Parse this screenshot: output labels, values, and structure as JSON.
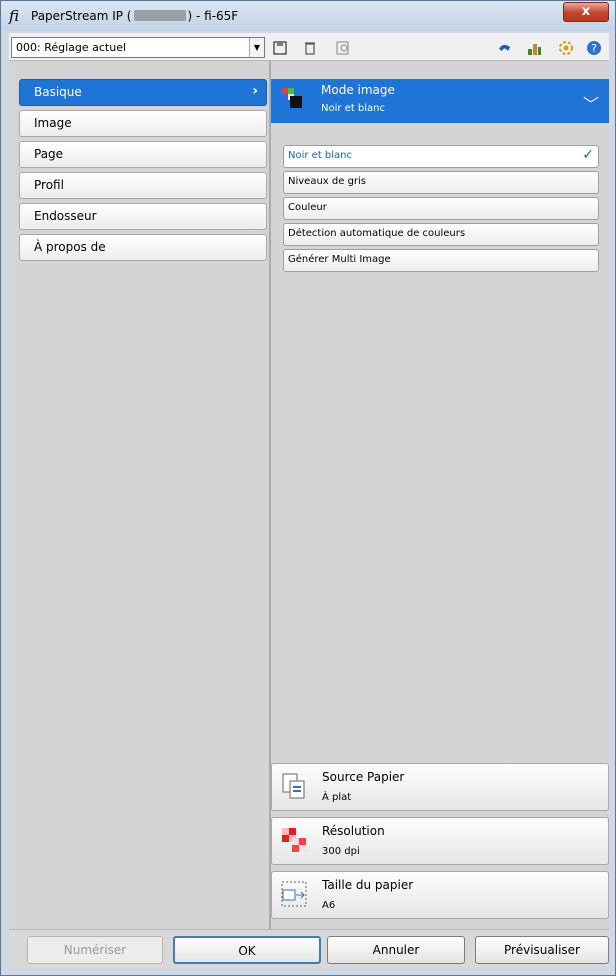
{
  "window": {
    "title_prefix": "PaperStream IP (",
    "title_suffix": ") - fi-65F",
    "close_label": "x"
  },
  "toolbar": {
    "preset_value": "000: Réglage actuel",
    "icons": [
      "save-icon",
      "delete-icon",
      "preview-scan-icon",
      "undo-icon",
      "profile-tree-icon",
      "settings-icon",
      "help-icon"
    ]
  },
  "nav": {
    "items": [
      {
        "label": "Basique",
        "active": true
      },
      {
        "label": "Image"
      },
      {
        "label": "Page"
      },
      {
        "label": "Profil"
      },
      {
        "label": "Endosseur"
      },
      {
        "label": "À propos de"
      }
    ]
  },
  "mode": {
    "title": "Mode image",
    "value": "Noir et blanc"
  },
  "options": [
    {
      "label": "Noir et blanc",
      "selected": true
    },
    {
      "label": "Niveaux de gris"
    },
    {
      "label": "Couleur"
    },
    {
      "label": "Détection automatique de couleurs"
    },
    {
      "label": "Générer Multi Image"
    }
  ],
  "cards": {
    "source": {
      "title": "Source Papier",
      "value": "À plat"
    },
    "resolution": {
      "title": "Résolution",
      "value": "300 dpi"
    },
    "paper": {
      "title": "Taille du papier",
      "value": "A6"
    }
  },
  "footer": {
    "scan": "Numériser",
    "ok": "OK",
    "cancel": "Annuler",
    "preview": "Prévisualiser"
  },
  "colors": {
    "accent": "#1f74d6",
    "close": "#c2432b"
  }
}
